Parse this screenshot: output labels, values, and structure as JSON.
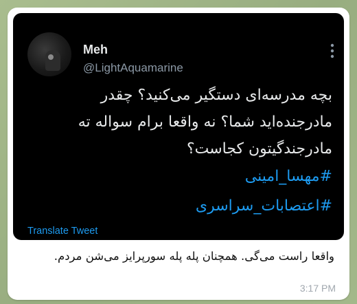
{
  "tweet": {
    "display_name": "Meh",
    "handle": "@LightAquamarine",
    "text": "بچه مدرسه‌ای دستگیر می‌کنید؟ چقدر مادرجنده‌اید شما؟ نه واقعا برام سواله ته مادرجندگیتون کجاست؟",
    "hashtags": [
      "#مهسا_امینی",
      "#اعتصابات_سراسری"
    ],
    "translate_label": "Translate Tweet",
    "colors": {
      "card_background": "#000000",
      "text": "#e7e9ea",
      "link": "#1d9bf0",
      "secondary": "#8b98a5"
    },
    "icons": {
      "avatar": "profile-photo",
      "menu": "more-vertical-icon"
    }
  },
  "message": {
    "caption": "واقعا راست می‌گی. همچنان پله پله سورپرایز می‌شن مردم.",
    "time": "3:17 PM"
  }
}
